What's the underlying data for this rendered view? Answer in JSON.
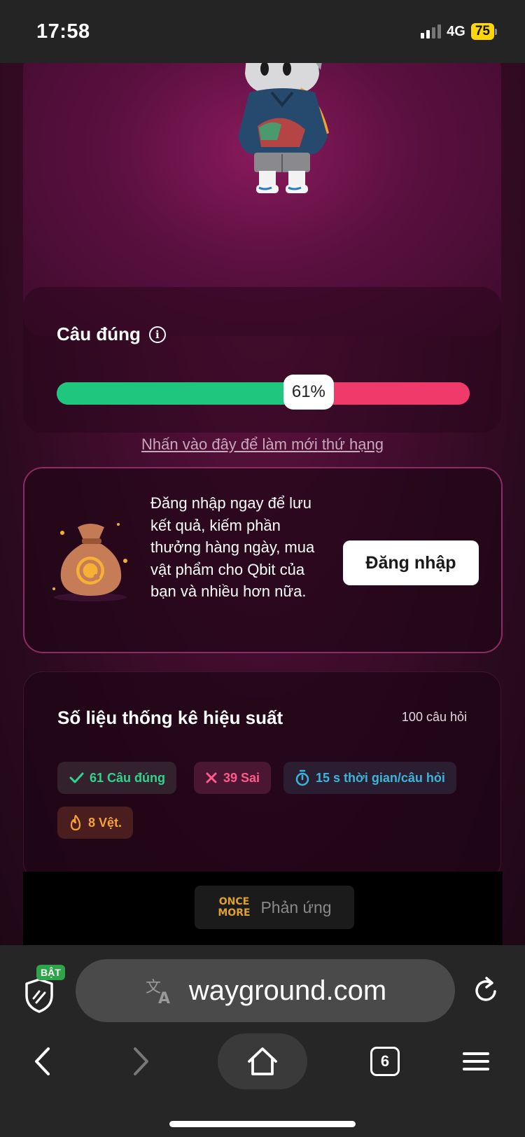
{
  "status_bar": {
    "time": "17:58",
    "network": "4G",
    "battery": "75"
  },
  "accuracy": {
    "title": "Câu đúng",
    "percent_label": "61%",
    "correct_fraction": 0.61,
    "colors": {
      "correct": "#1fc77e",
      "incorrect": "#f03a6a"
    }
  },
  "refresh_link": "Nhấn vào đây để làm mới thứ hạng",
  "login_promo": {
    "message": "Đăng nhập ngay để lưu kết quả, kiếm phần thưởng hàng ngày, mua vật phẩm cho Qbit của bạn và nhiều hơn nữa.",
    "button_label": "Đăng nhập"
  },
  "stats": {
    "title": "Số liệu thống kê hiệu suất",
    "question_count": "100 câu hỏi",
    "chips": {
      "correct": "61 Câu đúng",
      "wrong": "39 Sai",
      "time": "15 s thời gian/câu hỏi",
      "streak": "8 Vệt."
    }
  },
  "reaction": {
    "logo_line1": "ONCE",
    "logo_line2": "MORE",
    "label": "Phản ứng"
  },
  "browser": {
    "shield_badge": "BẬT",
    "url": "wayground.com",
    "tab_count": "6"
  },
  "icons": {
    "info": "info-icon",
    "check": "check-icon",
    "cross": "cross-icon",
    "timer": "timer-icon",
    "flame": "flame-icon",
    "translate": "translate-icon",
    "reload": "reload-icon",
    "back": "back-arrow-icon",
    "forward": "forward-arrow-icon",
    "home": "home-icon",
    "menu": "menu-icon",
    "shield": "shield-icon",
    "money_bag": "money-bag-icon",
    "avatar": "avatar-character"
  }
}
